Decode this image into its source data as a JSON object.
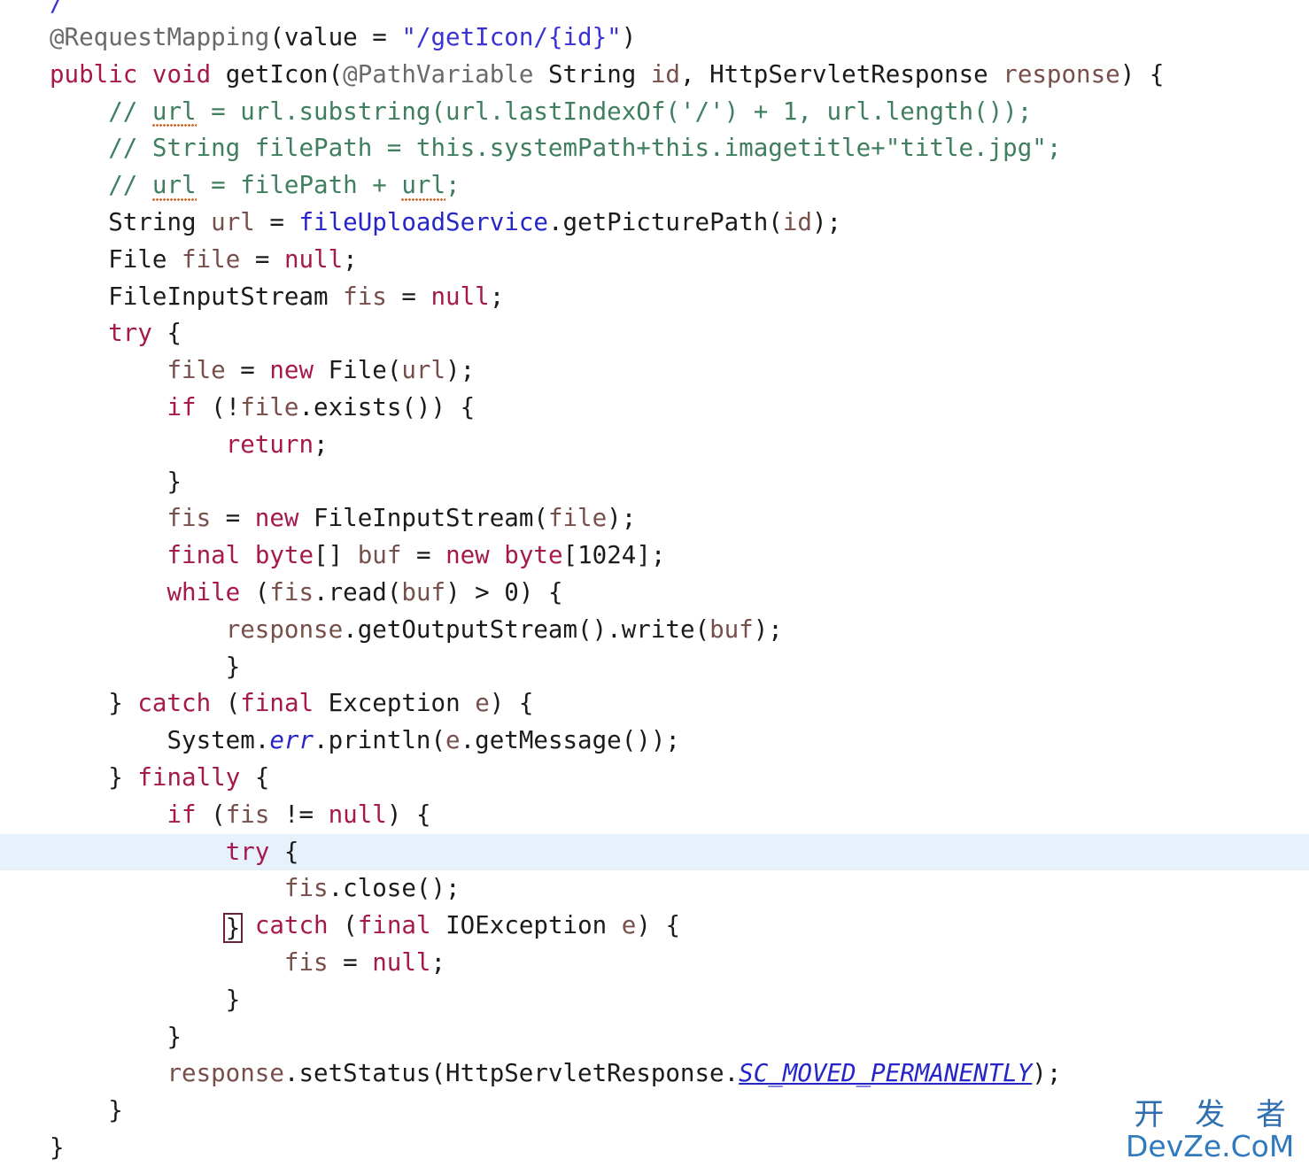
{
  "editor": {
    "language": "java",
    "background_color": "#ffffff",
    "highlight_line_color": "#e6f1fb",
    "highlighted_line_number": 22,
    "colors": {
      "plain": "#1b1b1b",
      "keyword": "#a6194d",
      "annotation": "#6a6a6a",
      "string": "#3a32d2",
      "comment": "#3f7f5f",
      "field": "#2626c8",
      "local_variable": "#77504b",
      "static_field": "#2626c8",
      "spellcheck_squiggle": "#d06a2a",
      "brace_match_outline": "#6b2039"
    }
  },
  "code": {
    "line_00": {
      "partial_glyph": "/"
    },
    "line_01": {
      "annotation": "@RequestMapping",
      "open_paren": "(value = ",
      "string": "\"/getIcon/{id}\"",
      "close_paren": ")"
    },
    "line_02": {
      "kw_public": "public",
      "kw_void": "void",
      "method": "getIcon",
      "p1": "(",
      "annotation": "@PathVariable",
      "type1": "String",
      "var1": "id",
      "comma": ", ",
      "type2": "HttpServletResponse",
      "var2": "response",
      "tail": ") {"
    },
    "line_03": {
      "indent": "    ",
      "prefix": "// ",
      "word": "url",
      "rest": " = url.substring(url.lastIndexOf('/') + 1, url.length());"
    },
    "line_04": {
      "indent": "    ",
      "text": "// String filePath = this.systemPath+this.imagetitle+\"title.jpg\";"
    },
    "line_05": {
      "indent": "    ",
      "prefix": "// ",
      "word1": "url",
      "mid": " = filePath + ",
      "word2": "url",
      "suffix": ";"
    },
    "line_06": {
      "indent": "    ",
      "type": "String",
      "var": "url",
      "eq": " = ",
      "field": "fileUploadService",
      "call": ".getPicturePath(",
      "arg": "id",
      "tail": ");"
    },
    "line_07": {
      "indent": "    ",
      "type": "File",
      "var": "file",
      "eq": " = ",
      "kw_null": "null",
      "tail": ";"
    },
    "line_08": {
      "indent": "    ",
      "type": "FileInputStream",
      "var": "fis",
      "eq": " = ",
      "kw_null": "null",
      "tail": ";"
    },
    "line_09": {
      "indent": "    ",
      "kw_try": "try",
      "tail": " {"
    },
    "line_10": {
      "indent": "        ",
      "var": "file",
      "eq": " = ",
      "kw_new": "new",
      "type": " File(",
      "arg": "url",
      "tail": ");"
    },
    "line_11": {
      "indent": "        ",
      "kw_if": "if",
      "open": " (!",
      "var": "file",
      "tail": ".exists()) {"
    },
    "line_12": {
      "indent": "            ",
      "kw_return": "return",
      "tail": ";"
    },
    "line_13": {
      "indent": "        ",
      "text": "}"
    },
    "line_14": {
      "indent": "        ",
      "var": "fis",
      "eq": " = ",
      "kw_new": "new",
      "type": " FileInputStream(",
      "arg": "file",
      "tail": ");"
    },
    "line_15": {
      "indent": "        ",
      "kw_final": "final",
      "kw_byte": "byte",
      "brackets": "[] ",
      "var": "buf",
      "eq": " = ",
      "kw_new": "new",
      "kw_byte2": "byte",
      "tail": "[1024];"
    },
    "line_16": {
      "indent": "        ",
      "kw_while": "while",
      "open": " (",
      "var": "fis",
      "mid": ".read(",
      "arg": "buf",
      "tail": ") > 0) {"
    },
    "line_17": {
      "indent": "            ",
      "var": "response",
      "mid": ".getOutputStream().write(",
      "arg": "buf",
      "tail": ");"
    },
    "line_18": {
      "indent": "            ",
      "text": "}"
    },
    "line_19": {
      "indent": "    ",
      "brace": "} ",
      "kw_catch": "catch",
      "open": " (",
      "kw_final": "final",
      "type": " Exception ",
      "var": "e",
      "tail": ") {"
    },
    "line_20": {
      "indent": "        ",
      "type": "System.",
      "static_field": "err",
      "mid": ".println(",
      "var": "e",
      "tail": ".getMessage());"
    },
    "line_21": {
      "indent": "    ",
      "brace": "} ",
      "kw_finally": "finally",
      "tail": " {"
    },
    "line_22": {
      "indent": "        ",
      "kw_if": "if",
      "open": " (",
      "var": "fis",
      "mid": " != ",
      "kw_null": "null",
      "tail": ") {"
    },
    "line_23": {
      "indent": "            ",
      "kw_try": "try",
      "tail": " {"
    },
    "line_24": {
      "indent": "                ",
      "var": "fis",
      "tail": ".close();"
    },
    "line_25": {
      "indent": "            ",
      "brace": "}",
      "space": " ",
      "kw_catch": "catch",
      "open": " (",
      "kw_final": "final",
      "type": " IOException ",
      "var": "e",
      "tail": ") {"
    },
    "line_26": {
      "indent": "                ",
      "var": "fis",
      "eq": " = ",
      "kw_null": "null",
      "tail": ";"
    },
    "line_27": {
      "indent": "            ",
      "text": "}"
    },
    "line_28": {
      "indent": "        ",
      "text": "}"
    },
    "line_29": {
      "indent": "        ",
      "var": "response",
      "mid": ".setStatus(HttpServletResponse.",
      "static_field": "SC_MOVED_PERMANENTLY",
      "tail": ");"
    },
    "line_30": {
      "indent": "    ",
      "text": "}"
    },
    "line_31": {
      "indent": "",
      "text": "}"
    }
  },
  "watermark": {
    "chinese": "开 发 者",
    "latin": "DevZe.CoM"
  }
}
